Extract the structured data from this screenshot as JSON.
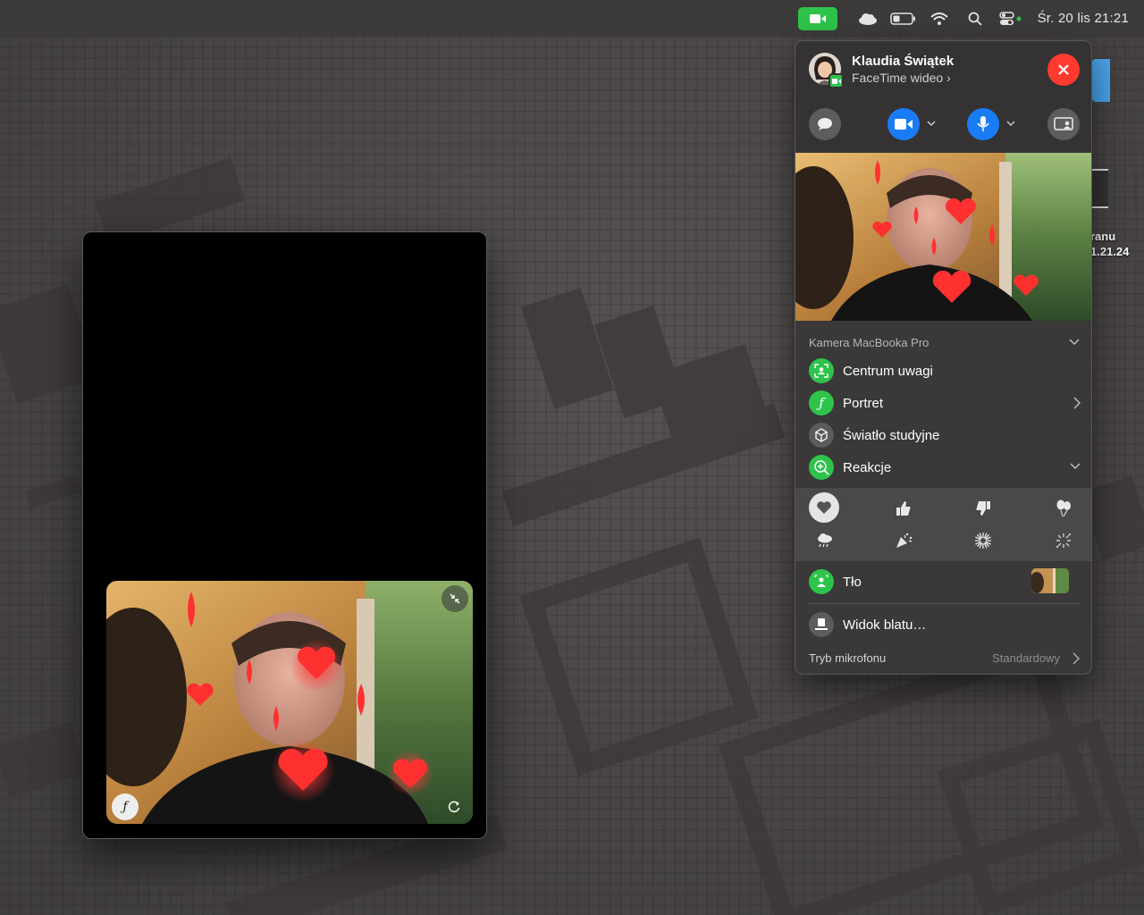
{
  "menubar": {
    "clock": "Śr. 20 lis  21:21",
    "icons": [
      "facetime-video-icon",
      "icloud-icon",
      "battery-icon",
      "wifi-icon",
      "search-icon",
      "control-center-icon"
    ]
  },
  "desktop": {
    "file_label_1": "ranu",
    "file_label_2": "1.21.24"
  },
  "panel": {
    "caller_name": "Klaudia Świątek",
    "caller_sub": "FaceTime wideo ›",
    "camera_section": "Kamera MacBooka Pro",
    "items": [
      {
        "label": "Centrum uwagi",
        "icon": "center-stage-icon"
      },
      {
        "label": "Portret",
        "icon": "portrait-icon"
      },
      {
        "label": "Światło studyjne",
        "icon": "studio-light-icon"
      },
      {
        "label": "Reakcje",
        "icon": "reactions-icon"
      }
    ],
    "reactions": [
      "heart",
      "thumbs-up",
      "thumbs-down",
      "balloons",
      "rain",
      "confetti",
      "fireworks",
      "sparkle"
    ],
    "background_label": "Tło",
    "desk_view_label": "Widok blatu…",
    "mic_mode_label": "Tryb mikrofonu",
    "mic_mode_value": "Standardowy"
  },
  "colors": {
    "facetime_green": "#2ec44b",
    "close_red": "#ff3b30",
    "active_blue": "#1a7cf5"
  }
}
